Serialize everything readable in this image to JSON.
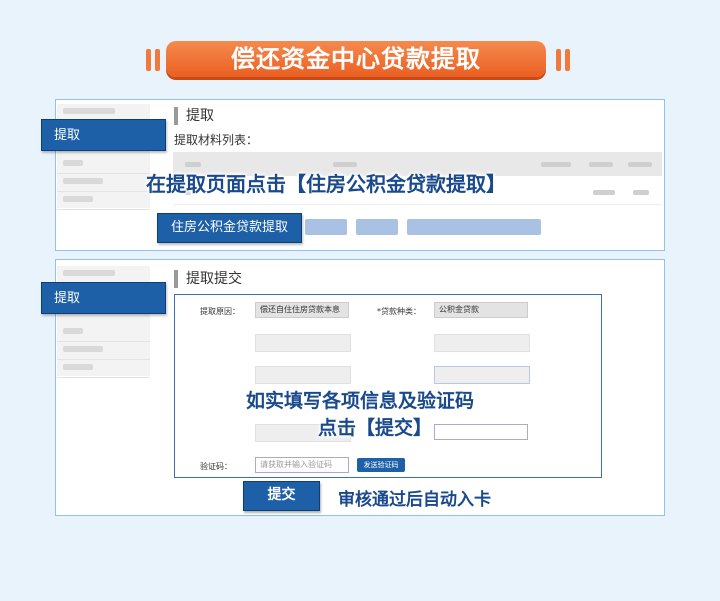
{
  "banner": {
    "title": "偿还资金中心贷款提取"
  },
  "panel1": {
    "tab_label": "提取",
    "heading": "提取",
    "subheading": "提取材料列表：",
    "instruction": "在提取页面点击【住房公积金贷款提取】",
    "primary_button": "住房公积金贷款提取"
  },
  "panel2": {
    "tab_label": "提取",
    "heading": "提取提交",
    "form": {
      "reason_label": "提取原因：",
      "reason_value": "偿还自住住房贷款本息",
      "loan_type_label": "*贷款种类：",
      "loan_type_value": "公积金贷款",
      "captcha_label": "验证码：",
      "captcha_placeholder": "请获取并输入验证码",
      "send_button": "发送验证码"
    },
    "instruction_line1": "如实填写各项信息及验证码",
    "instruction_line2": "点击【提交】",
    "submit_button": "提交",
    "result_text": "审核通过后自动入卡"
  }
}
